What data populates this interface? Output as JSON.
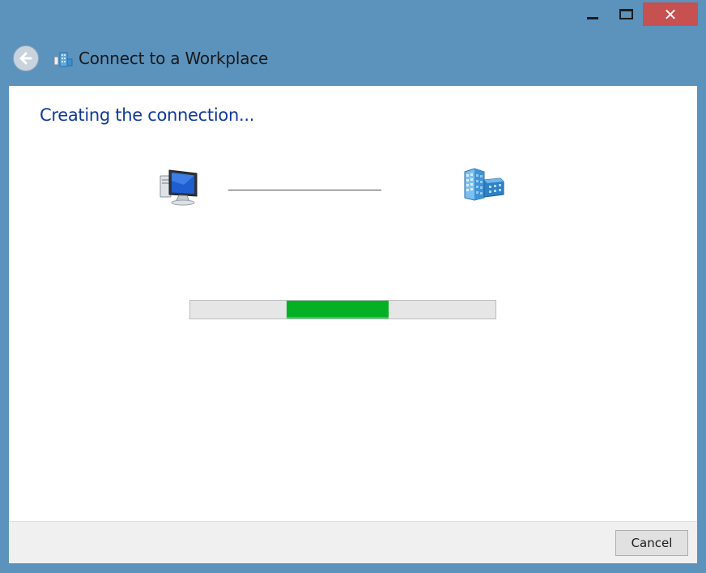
{
  "window": {
    "title": "Connect to a Workplace",
    "controls": {
      "minimize_icon": "minimize-icon",
      "maximize_icon": "maximize-icon",
      "close_glyph": "✕"
    },
    "frame_color": "#5b93bd",
    "close_color": "#c75050"
  },
  "header": {
    "back_icon": "back-arrow-icon",
    "app_icon": "workplace-network-icon"
  },
  "main": {
    "heading": "Creating the connection...",
    "heading_color": "#10399b",
    "left_icon": "computer-icon",
    "right_icon": "workplace-server-icon",
    "progress": {
      "mode": "indeterminate-marquee",
      "segment_start": 0.315,
      "segment_end": 0.65,
      "fill_color": "#06b025"
    }
  },
  "footer": {
    "cancel_label": "Cancel"
  }
}
